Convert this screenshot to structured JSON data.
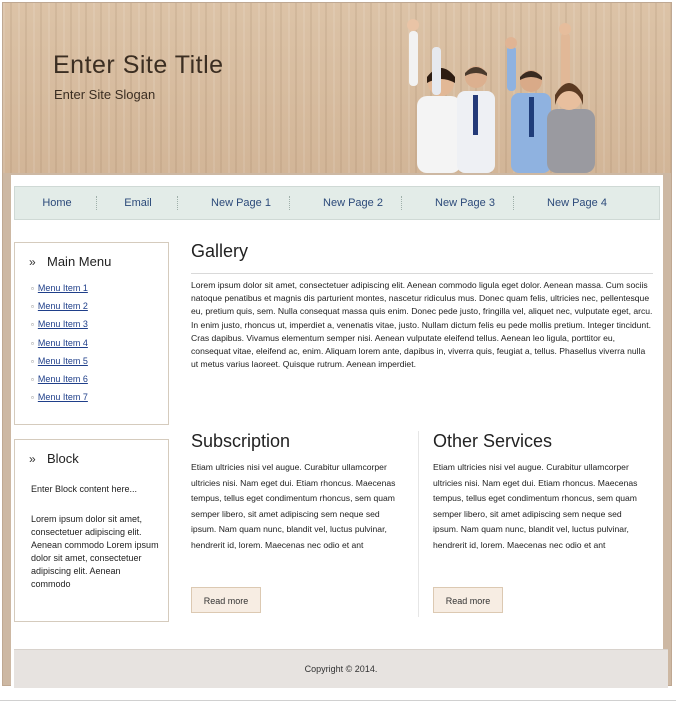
{
  "header": {
    "site_title": "Enter Site Title",
    "site_slogan": "Enter Site Slogan"
  },
  "nav": {
    "items": [
      "Home",
      "Email",
      "New Page 1",
      "New Page 2",
      "New Page 3",
      "New Page 4"
    ]
  },
  "main_menu": {
    "title": "Main Menu",
    "items": [
      "Menu Item 1",
      "Menu Item 2",
      "Menu Item 3",
      "Menu Item 4",
      "Menu Item 5",
      "Menu Item 6",
      "Menu Item 7"
    ]
  },
  "block": {
    "title": "Block",
    "intro": "Enter Block content here...",
    "body": "Lorem ipsum dolor sit amet, consectetuer adipiscing elit. Aenean commodo Lorem ipsum dolor sit amet, consectetuer adipiscing elit. Aenean commodo"
  },
  "gallery": {
    "title": "Gallery",
    "text": "Lorem ipsum dolor sit amet, consectetuer adipiscing elit. Aenean commodo ligula eget dolor. Aenean massa. Cum sociis natoque penatibus et magnis dis parturient montes, nascetur ridiculus mus. Donec quam felis, ultricies nec, pellentesque eu, pretium quis, sem. Nulla consequat massa quis enim. Donec pede justo, fringilla vel, aliquet nec, vulputate eget, arcu. In enim justo, rhoncus ut, imperdiet a, venenatis vitae, justo. Nullam dictum felis eu pede mollis pretium. Integer tincidunt. Cras dapibus. Vivamus elementum semper nisi. Aenean vulputate eleifend tellus. Aenean leo ligula, porttitor eu, consequat vitae, eleifend ac, enim. Aliquam lorem ante, dapibus in, viverra quis, feugiat a, tellus. Phasellus viverra nulla ut metus varius laoreet. Quisque rutrum. Aenean imperdiet."
  },
  "subscription": {
    "title": "Subscription",
    "text": "Etiam ultricies nisi vel augue. Curabitur ullamcorper ultricies nisi. Nam eget dui. Etiam rhoncus. Maecenas tempus, tellus eget condimentum rhoncus, sem quam semper libero, sit amet adipiscing sem neque sed ipsum. Nam quam nunc, blandit vel, luctus pulvinar, hendrerit id, lorem. Maecenas nec odio et ant",
    "button": "Read more"
  },
  "other_services": {
    "title": "Other Services",
    "text": "Etiam ultricies nisi vel augue. Curabitur ullamcorper ultricies nisi. Nam eget dui. Etiam rhoncus. Maecenas tempus, tellus eget condimentum rhoncus, sem quam semper libero, sit amet adipiscing sem neque sed ipsum. Nam quam nunc, blandit vel, luctus pulvinar, hendrerit id, lorem. Maecenas nec odio et ant",
    "button": "Read more"
  },
  "footer": {
    "copyright": "Copyright © 2014."
  }
}
